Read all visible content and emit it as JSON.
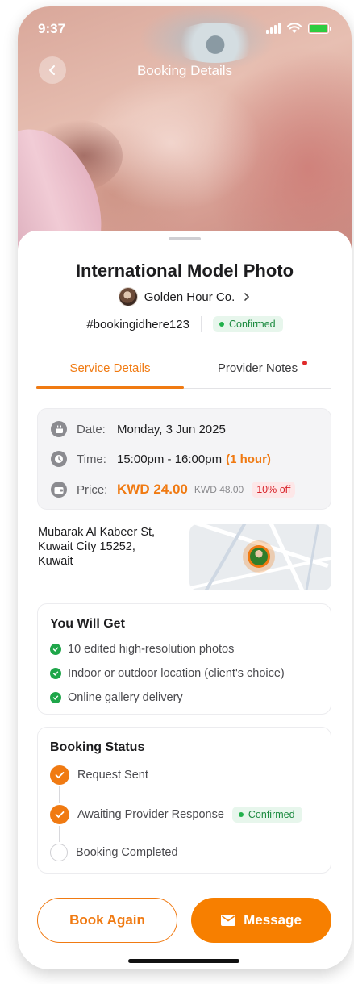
{
  "status_bar": {
    "time": "9:37"
  },
  "header": {
    "title": "Booking Details"
  },
  "service": {
    "title": "International Model Photo"
  },
  "provider": {
    "name": "Golden Hour Co."
  },
  "booking": {
    "id": "#bookingidhere123",
    "status": "Confirmed"
  },
  "tabs": [
    {
      "label": "Service Details",
      "active": true
    },
    {
      "label": "Provider Notes",
      "active": false,
      "has_notification": true
    }
  ],
  "details": {
    "date_label": "Date:",
    "date_value": "Monday, 3 Jun 2025",
    "time_label": "Time:",
    "time_value": "15:00pm - 16:00pm",
    "duration": "(1 hour)",
    "price_label": "Price:",
    "price": "KWD 24.00",
    "original_price": "KWD 48.00",
    "discount": "10% off"
  },
  "location": {
    "line1": "Mubarak Al Kabeer St,",
    "line2": "Kuwait City 15252,",
    "line3": "Kuwait"
  },
  "you_will_get": {
    "title": "You Will Get",
    "items": [
      "10 edited high-resolution photos",
      "Indoor or outdoor location (client's choice)",
      "Online gallery delivery"
    ]
  },
  "booking_status": {
    "title": "Booking Status",
    "steps": [
      {
        "label": "Request Sent",
        "done": true
      },
      {
        "label": "Awaiting Provider Response",
        "done": true,
        "badge": "Confirmed"
      },
      {
        "label": "Booking Completed",
        "done": false
      }
    ]
  },
  "actions": {
    "book_again": "Book Again",
    "message": "Message"
  },
  "colors": {
    "accent": "#f07a12",
    "success": "#1fa64a",
    "danger": "#d8232a"
  }
}
